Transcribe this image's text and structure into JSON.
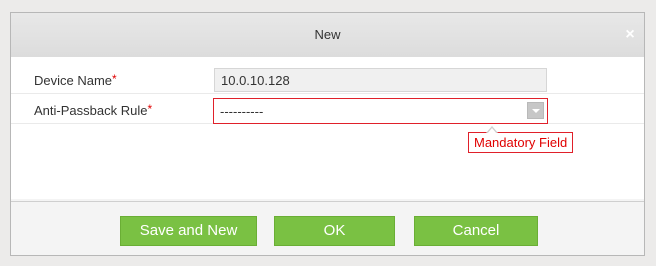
{
  "dialog": {
    "title": "New",
    "close_icon": "close-icon",
    "close_glyph": "×"
  },
  "form": {
    "device_name": {
      "label": "Device Name",
      "required_mark": "*",
      "value": "10.0.10.128"
    },
    "anti_passback_rule": {
      "label": "Anti-Passback Rule",
      "required_mark": "*",
      "value": "----------",
      "dropdown_icon": "chevron-down-icon",
      "validation_message": "Mandatory Field"
    }
  },
  "buttons": {
    "save_and_new": "Save and New",
    "ok": "OK",
    "cancel": "Cancel"
  },
  "colors": {
    "accent_green": "#7ac143",
    "error_red": "#e00000"
  }
}
